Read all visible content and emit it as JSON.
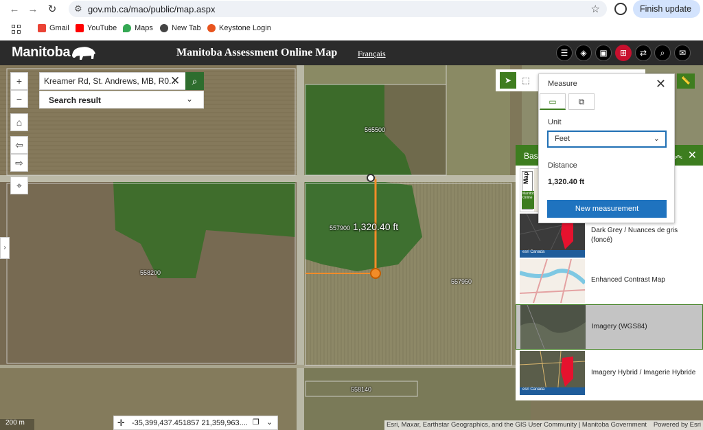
{
  "browser": {
    "url": "gov.mb.ca/mao/public/map.aspx",
    "finish_update": "Finish update"
  },
  "bookmarks": [
    {
      "label": "Gmail",
      "color": "#ea4335"
    },
    {
      "label": "YouTube",
      "color": "#ff0000"
    },
    {
      "label": "Maps",
      "color": "#34a853"
    },
    {
      "label": "New Tab",
      "color": "#444444"
    },
    {
      "label": "Keystone Login",
      "color": "#e8541e"
    }
  ],
  "header": {
    "logo": "Manitoba",
    "title": "Manitoba Assessment Online Map",
    "language_link": "Français"
  },
  "search": {
    "value": "Kreamer Rd, St. Andrews, MB, R0...",
    "result_label": "Search result"
  },
  "map": {
    "parcels": [
      "565500",
      "557900",
      "558200",
      "557950",
      "558140"
    ],
    "measure_label": "1,320.40 ft",
    "scale": "200 m",
    "coordinates": "-35,399,437.451857 21,359,963....",
    "attribution": "Esri, Maxar, Earthstar Geographics, and the GIS User Community | Manitoba Government",
    "powered_by": "Powered by Esri"
  },
  "measure": {
    "title": "Measure",
    "unit_label": "Unit",
    "unit_value": "Feet",
    "distance_label": "Distance",
    "distance_value": "1,320.40 ft",
    "new_button": "New measurement"
  },
  "basemap": {
    "header": "Base",
    "items": [
      {
        "label": "Dark Grey / Nuances de gris (foncé)",
        "selected": false
      },
      {
        "label": "Enhanced Contrast Map",
        "selected": false
      },
      {
        "label": "Imagery (WGS84)",
        "selected": true
      },
      {
        "label": "Imagery Hybrid / Imagerie Hybride",
        "selected": false
      }
    ],
    "first_thumb_text": "Map",
    "first_thumb_sub": "Manitoba Online",
    "esri_badge": "esri Canada"
  },
  "colors": {
    "accent_green": "#3d7d1f",
    "header_bg": "#2b2b2b",
    "measure_line": "#f28c28",
    "button_blue": "#1f73bf"
  }
}
